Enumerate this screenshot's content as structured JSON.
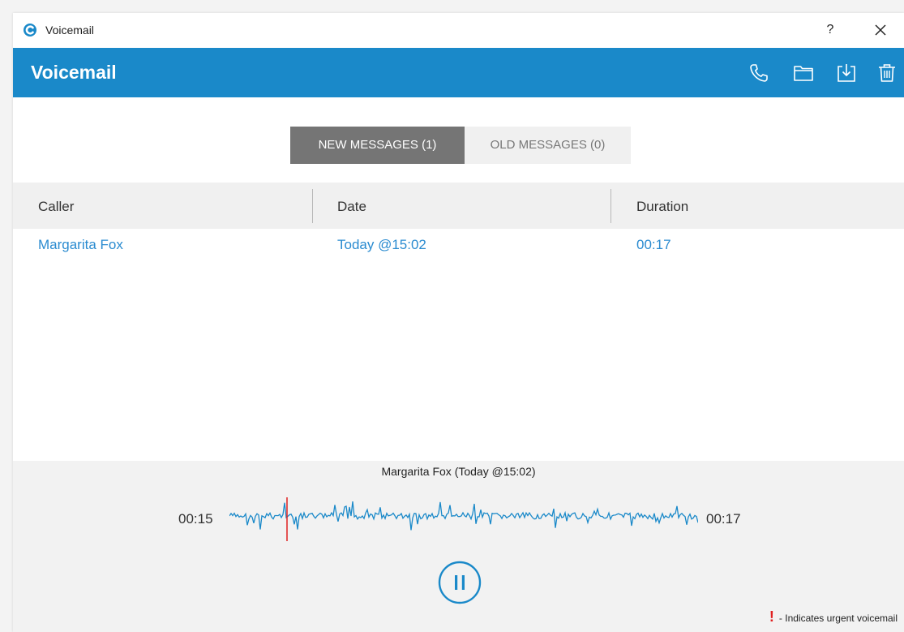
{
  "window": {
    "title": "Voicemail",
    "help_label": "?"
  },
  "header": {
    "title": "Voicemail",
    "icons": [
      "phone-icon",
      "folder-icon",
      "download-icon",
      "trash-icon"
    ]
  },
  "tabs": [
    {
      "label": "NEW MESSAGES (1)",
      "active": true
    },
    {
      "label": "OLD MESSAGES (0)",
      "active": false
    }
  ],
  "table": {
    "columns": [
      "Caller",
      "Date",
      "Duration"
    ],
    "rows": [
      {
        "caller": "Margarita Fox",
        "date": "Today @15:02",
        "duration": "00:17"
      }
    ]
  },
  "player": {
    "title": "Margarita Fox (Today @15:02)",
    "current_time": "00:15",
    "total_time": "00:17",
    "playing": true
  },
  "legend": {
    "mark": "!",
    "text": "- Indicates urgent voicemail"
  },
  "colors": {
    "accent": "#1a89c9",
    "link": "#2a8bd0",
    "playhead": "#e02020",
    "tab_active": "#757575"
  }
}
